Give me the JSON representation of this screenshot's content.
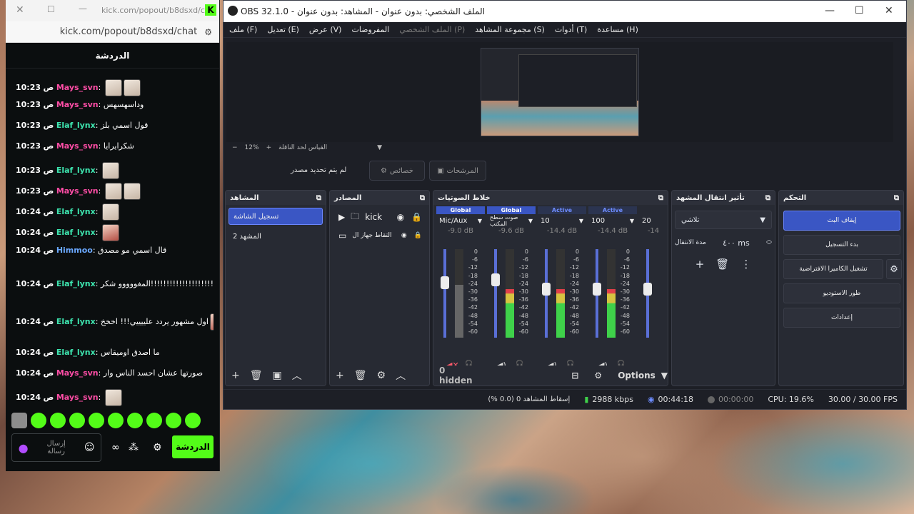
{
  "browser": {
    "title": "kick.com/popout/b8dsxd/c...",
    "url": "kick.com/popout/b8dsxd/chat",
    "chat_title": "الدردشة",
    "messages": [
      {
        "time": "10:23",
        "ampm": "ص",
        "user": "Mays_svn",
        "color": "#ff4da6",
        "text": ""
      },
      {
        "time": "10:23",
        "ampm": "ص",
        "user": "Mays_svn",
        "color": "#ff4da6",
        "text": "وداسهسهس"
      },
      {
        "time": "10:23",
        "ampm": "ص",
        "user": "Elaf_lynx",
        "color": "#3ee6b0",
        "text": "قول اسمي بلز"
      },
      {
        "time": "10:23",
        "ampm": "ص",
        "user": "Mays_svn",
        "color": "#ff4da6",
        "text": "شكرايرايا"
      },
      {
        "time": "10:23",
        "ampm": "ص",
        "user": "Elaf_lynx",
        "color": "#3ee6b0",
        "text": ""
      },
      {
        "time": "10:23",
        "ampm": "ص",
        "user": "Mays_svn",
        "color": "#ff4da6",
        "text": ""
      },
      {
        "time": "10:24",
        "ampm": "ص",
        "user": "Elaf_lynx",
        "color": "#3ee6b0",
        "text": ""
      },
      {
        "time": "10:24",
        "ampm": "ص",
        "user": "Elaf_lynx",
        "color": "#3ee6b0",
        "text": ""
      },
      {
        "time": "10:24",
        "ampm": "ص",
        "user": "Himmoo",
        "color": "#6aa8ff",
        "text": "قال اسمي مو مصدق"
      },
      {
        "time": "10:24",
        "ampm": "ص",
        "user": "Elaf_lynx",
        "color": "#3ee6b0",
        "text": "المغووووو شكر!!!!!!!!!!!!!!!!!!!!!!!!"
      },
      {
        "time": "10:24",
        "ampm": "ص",
        "user": "Elaf_lynx",
        "color": "#3ee6b0",
        "text": "اول مشهور يردد علييييي!!! اخخخ"
      },
      {
        "time": "10:24",
        "ampm": "ص",
        "user": "Elaf_lynx",
        "color": "#3ee6b0",
        "text": "ما اصدق اوميقاس"
      },
      {
        "time": "10:24",
        "ampm": "ص",
        "user": "Mays_svn",
        "color": "#ff4da6",
        "text": "صورتها عشان احسد الناس وار"
      },
      {
        "time": "10:24",
        "ampm": "ص",
        "user": "Mays_svn",
        "color": "#ff4da6",
        "text": ""
      }
    ],
    "chat_button": "الدردشة",
    "send_placeholder": "إرسال رسالة"
  },
  "obs": {
    "title": "OBS 32.1.0 - الملف الشخصي: بدون عنوان - المشاهد: بدون عنوان",
    "menu": [
      "ملف (F)",
      "تعديل (E)",
      "عرض (V)",
      "المفروضات",
      "الملف الشخصي (P)",
      "مجموعة المشاهد (S)",
      "أدوات (T)",
      "مساعدة (H)"
    ],
    "zoom": "12%",
    "preview_label": "القياس لحد الناقلة",
    "context_text": "لم يتم تحديد مصدر",
    "properties_btn": "خصائص",
    "filters_btn": "المرشحات",
    "scenes_title": "المشاهد",
    "scenes": [
      "تسجيل الشاشة",
      "المشهد 2"
    ],
    "sources_title": "المصادر",
    "sources": [
      "kick",
      "التقاط جهاز ال"
    ],
    "mixer_title": "خلاط الصوتيات",
    "mixer": [
      {
        "tag": "Global",
        "name": "Mic/Aux",
        "db": "-9.0 dB"
      },
      {
        "tag": "Global",
        "name": "صوت سطح المكتب",
        "db": "-9.6 dB"
      },
      {
        "tag": "Active",
        "name": "10",
        "db": "-14.4 dB"
      },
      {
        "tag": "Active",
        "name": "100",
        "db": "-14.4 dB"
      },
      {
        "tag": "",
        "name": "20",
        "db": "-14"
      }
    ],
    "scale": [
      "0",
      "-6",
      "-12",
      "-18",
      "-24",
      "-30",
      "-36",
      "-42",
      "-48",
      "-54",
      "-60"
    ],
    "hidden": "0 hidden",
    "options": "Options",
    "transitions_title": "تأثير انتقال المشهد",
    "transition": "تلاشي",
    "duration_label": "مدة الانتقال",
    "duration": "٤٠٠ ms",
    "controls_title": "التحكم",
    "controls": [
      "إيقاف البث",
      "بدء التسجيل",
      "تشغيل الكاميرا الافتراضية",
      "طور الاستوديو",
      "إعدادات"
    ],
    "status": {
      "dropped": "إسقاط المشاهد 0 (0.0 %)",
      "kbps": "2988 kbps",
      "stream_time": "00:44:18",
      "rec_time": "00:00:00",
      "cpu": "CPU: 19.6%",
      "fps": "30.00 / 30.00 FPS"
    }
  }
}
